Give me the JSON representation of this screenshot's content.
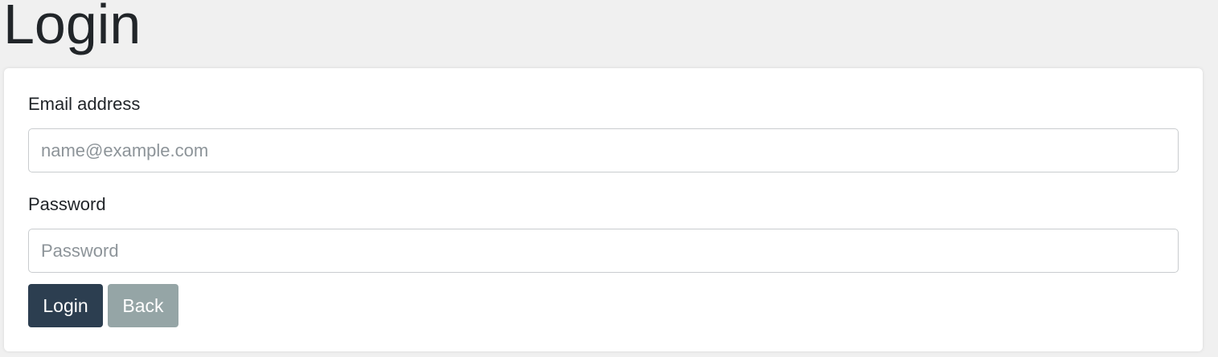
{
  "page": {
    "title": "Login"
  },
  "form": {
    "email_label": "Email address",
    "email_value": "",
    "email_placeholder": "name@example.com",
    "password_label": "Password",
    "password_value": "",
    "password_placeholder": "Password",
    "login_button": "Login",
    "back_button": "Back"
  },
  "colors": {
    "primary": "#2c3e50",
    "secondary": "#95a5a6",
    "background": "#f0f0f0"
  }
}
